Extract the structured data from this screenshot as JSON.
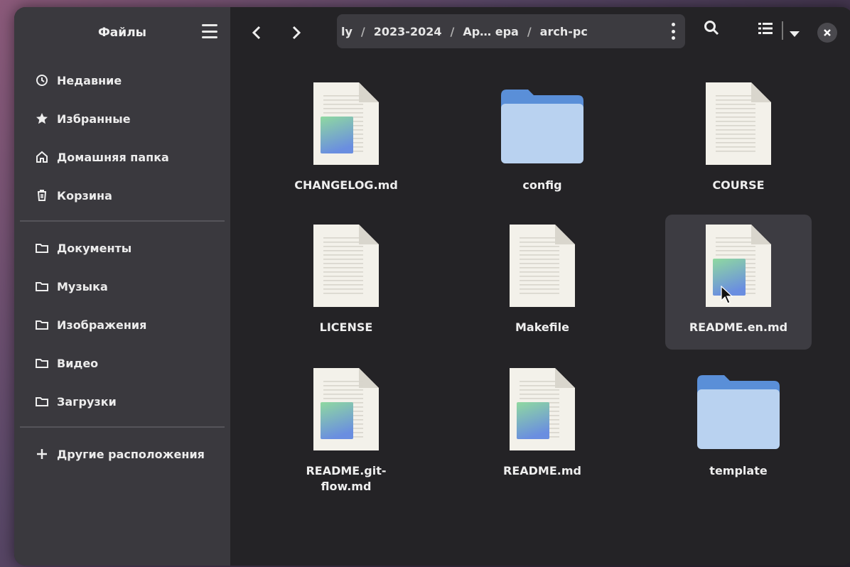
{
  "sidebar": {
    "title": "Файлы",
    "places": [
      {
        "label": "Недавние",
        "icon": "clock-icon"
      },
      {
        "label": "Избранные",
        "icon": "star-icon"
      },
      {
        "label": "Домашняя папка",
        "icon": "home-icon"
      },
      {
        "label": "Корзина",
        "icon": "trash-icon"
      }
    ],
    "bookmarks": [
      {
        "label": "Документы",
        "icon": "folder-icon"
      },
      {
        "label": "Музыка",
        "icon": "folder-icon"
      },
      {
        "label": "Изображения",
        "icon": "folder-icon"
      },
      {
        "label": "Видео",
        "icon": "folder-icon"
      },
      {
        "label": "Загрузки",
        "icon": "folder-icon"
      }
    ],
    "other": {
      "label": "Другие расположения",
      "icon": "plus-icon"
    }
  },
  "pathbar": {
    "crumbs": [
      "ly",
      "2023-2024",
      "Ар… ера",
      "arch-pc"
    ]
  },
  "files": [
    {
      "name": "CHANGELOG.md",
      "type": "doc-image"
    },
    {
      "name": "config",
      "type": "folder"
    },
    {
      "name": "COURSE",
      "type": "doc"
    },
    {
      "name": "LICENSE",
      "type": "doc"
    },
    {
      "name": "Makefile",
      "type": "doc"
    },
    {
      "name": "README.en.md",
      "type": "doc-image",
      "selected": true
    },
    {
      "name": "README.git-flow.md",
      "type": "doc-image",
      "display": "README.git-\nflow.md"
    },
    {
      "name": "README.md",
      "type": "doc-image"
    },
    {
      "name": "template",
      "type": "folder"
    }
  ],
  "colors": {
    "folder_tab": "#5a8fd8",
    "folder_body": "#b9d2f0",
    "doc_paper": "#f3f1ea"
  }
}
